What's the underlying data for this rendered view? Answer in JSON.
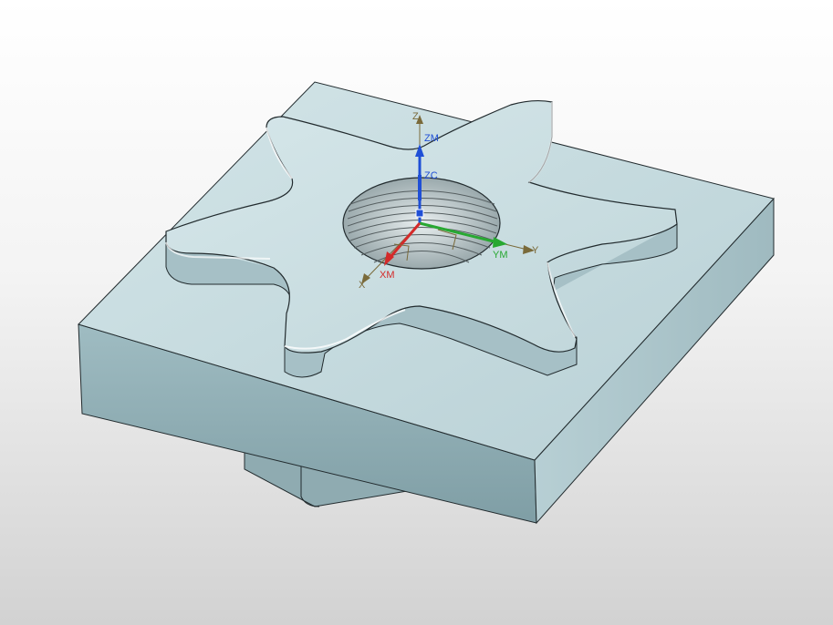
{
  "scene": {
    "model": "threaded-star-boss-on-square-block",
    "body_color": "#bcd4d9",
    "top_face_color": "#c9dde1",
    "side_face_color": "#a9c4ca",
    "edge_color": "#222b2e",
    "background_top": "#ffffff",
    "background_bottom": "#d2d2d2"
  },
  "csys": {
    "zm": "ZM",
    "zc": "ZC",
    "ym": "YM",
    "xm": "XM",
    "x_color": "#d42a2a",
    "y_color": "#28a832",
    "z_color": "#1f4fd6",
    "wcs": {
      "z": "Z",
      "y": "Y",
      "x": "X"
    }
  }
}
